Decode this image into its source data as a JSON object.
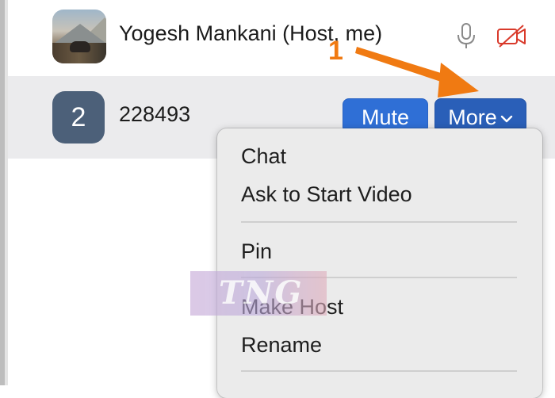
{
  "participants": [
    {
      "name": "Yogesh Mankani (Host, me)",
      "avatar": "photo",
      "icons": [
        "microphone-icon",
        "video-off-icon"
      ]
    },
    {
      "name": "228493",
      "avatar_initial": "2",
      "mute_label": "Mute",
      "more_label": "More"
    }
  ],
  "annotation": {
    "step_number": "1",
    "color": "#f07a12"
  },
  "context_menu": {
    "items": [
      "Chat",
      "Ask to Start Video",
      "Pin",
      "Make Host",
      "Rename"
    ]
  },
  "watermark": {
    "text": "TNG"
  },
  "colors": {
    "button_blue": "#2f6fd6",
    "avatar_slate": "#4c6079",
    "video_off_red": "#d93a2b",
    "annotation_orange": "#f07a12"
  }
}
